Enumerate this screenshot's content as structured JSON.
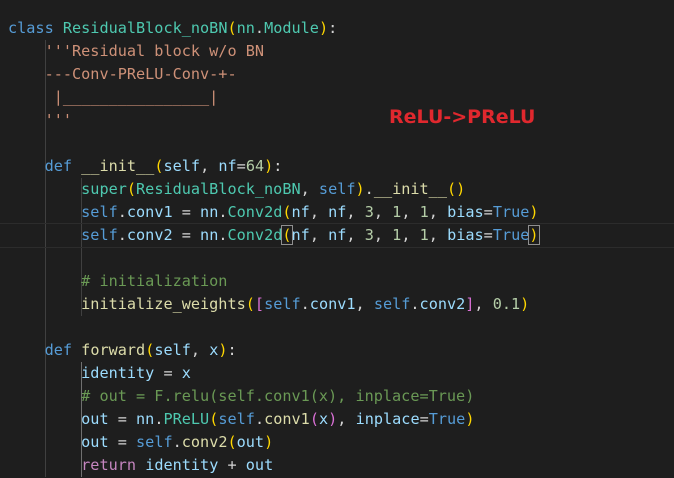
{
  "theme": {
    "background": "#1e1e1e",
    "foreground": "#d4d4d4",
    "keyword": "#569cd6",
    "control": "#c586c0",
    "class_name": "#4ec9b0",
    "function": "#dcdcaa",
    "variable": "#9cdcfe",
    "number": "#b5cea8",
    "string": "#ce9178",
    "comment": "#6a9955",
    "bracket_1": "#ffd700",
    "bracket_2": "#da70d6",
    "bracket_3": "#179fff",
    "annotation": "#e0282e"
  },
  "annotation": {
    "text": "ReLU->PReLU"
  },
  "code": {
    "lines": [
      [
        [
          "class",
          "keyword"
        ],
        [
          " ",
          "plain"
        ],
        [
          "ResidualBlock_noBN",
          "class_name"
        ],
        [
          "(",
          "bracket_1"
        ],
        [
          "nn",
          "class_name"
        ],
        [
          ".",
          "plain"
        ],
        [
          "Module",
          "class_name"
        ],
        [
          ")",
          "bracket_1"
        ],
        [
          ":",
          "plain"
        ]
      ],
      [
        [
          "    ",
          "plain"
        ],
        [
          "'''Residual block w/o BN",
          "string"
        ]
      ],
      [
        [
          "    ",
          "plain"
        ],
        [
          "---Conv-PReLU-Conv-+-",
          "string"
        ]
      ],
      [
        [
          "     ",
          "plain"
        ],
        [
          "|________________|",
          "string"
        ]
      ],
      [
        [
          "    ",
          "plain"
        ],
        [
          "'''",
          "string"
        ]
      ],
      [],
      [
        [
          "    ",
          "plain"
        ],
        [
          "def",
          "keyword"
        ],
        [
          " ",
          "plain"
        ],
        [
          "__init__",
          "function"
        ],
        [
          "(",
          "bracket_1"
        ],
        [
          "self",
          "variable"
        ],
        [
          ", ",
          "plain"
        ],
        [
          "nf",
          "variable"
        ],
        [
          "=",
          "plain"
        ],
        [
          "64",
          "number"
        ],
        [
          ")",
          "bracket_1"
        ],
        [
          ":",
          "plain"
        ]
      ],
      [
        [
          "        ",
          "plain"
        ],
        [
          "super",
          "class_name"
        ],
        [
          "(",
          "bracket_1"
        ],
        [
          "ResidualBlock_noBN",
          "class_name"
        ],
        [
          ", ",
          "plain"
        ],
        [
          "self",
          "keyword"
        ],
        [
          ")",
          "bracket_1"
        ],
        [
          ".",
          "plain"
        ],
        [
          "__init__",
          "function"
        ],
        [
          "()",
          "bracket_1"
        ]
      ],
      [
        [
          "        ",
          "plain"
        ],
        [
          "self",
          "keyword"
        ],
        [
          ".",
          "plain"
        ],
        [
          "conv1",
          "variable"
        ],
        [
          " = ",
          "plain"
        ],
        [
          "nn",
          "variable"
        ],
        [
          ".",
          "plain"
        ],
        [
          "Conv2d",
          "class_name"
        ],
        [
          "(",
          "bracket_1"
        ],
        [
          "nf",
          "variable"
        ],
        [
          ", ",
          "plain"
        ],
        [
          "nf",
          "variable"
        ],
        [
          ", ",
          "plain"
        ],
        [
          "3",
          "number"
        ],
        [
          ", ",
          "plain"
        ],
        [
          "1",
          "number"
        ],
        [
          ", ",
          "plain"
        ],
        [
          "1",
          "number"
        ],
        [
          ", ",
          "plain"
        ],
        [
          "bias",
          "variable"
        ],
        [
          "=",
          "plain"
        ],
        [
          "True",
          "keyword"
        ],
        [
          ")",
          "bracket_1"
        ]
      ],
      [
        [
          "        ",
          "plain"
        ],
        [
          "self",
          "keyword"
        ],
        [
          ".",
          "plain"
        ],
        [
          "conv2",
          "variable"
        ],
        [
          " = ",
          "plain"
        ],
        [
          "nn",
          "variable"
        ],
        [
          ".",
          "plain"
        ],
        [
          "Conv2d",
          "class_name"
        ],
        [
          "(",
          "bracket_1",
          "bm"
        ],
        [
          "nf",
          "variable"
        ],
        [
          ", ",
          "plain"
        ],
        [
          "nf",
          "variable"
        ],
        [
          ", ",
          "plain"
        ],
        [
          "3",
          "number"
        ],
        [
          ", ",
          "plain"
        ],
        [
          "1",
          "number"
        ],
        [
          ", ",
          "plain"
        ],
        [
          "1",
          "number"
        ],
        [
          ", ",
          "plain"
        ],
        [
          "bias",
          "variable"
        ],
        [
          "=",
          "plain"
        ],
        [
          "True",
          "keyword"
        ],
        [
          ")",
          "bracket_1",
          "bm"
        ]
      ],
      [],
      [
        [
          "        ",
          "plain"
        ],
        [
          "# initialization",
          "comment"
        ]
      ],
      [
        [
          "        ",
          "plain"
        ],
        [
          "initialize_weights",
          "function"
        ],
        [
          "(",
          "bracket_1"
        ],
        [
          "[",
          "bracket_2"
        ],
        [
          "self",
          "keyword"
        ],
        [
          ".",
          "plain"
        ],
        [
          "conv1",
          "variable"
        ],
        [
          ", ",
          "plain"
        ],
        [
          "self",
          "keyword"
        ],
        [
          ".",
          "plain"
        ],
        [
          "conv2",
          "variable"
        ],
        [
          "]",
          "bracket_2"
        ],
        [
          ", ",
          "plain"
        ],
        [
          "0.1",
          "number"
        ],
        [
          ")",
          "bracket_1"
        ]
      ],
      [],
      [
        [
          "    ",
          "plain"
        ],
        [
          "def",
          "keyword"
        ],
        [
          " ",
          "plain"
        ],
        [
          "forward",
          "function"
        ],
        [
          "(",
          "bracket_1"
        ],
        [
          "self",
          "variable"
        ],
        [
          ", ",
          "plain"
        ],
        [
          "x",
          "variable"
        ],
        [
          ")",
          "bracket_1"
        ],
        [
          ":",
          "plain"
        ]
      ],
      [
        [
          "        ",
          "plain"
        ],
        [
          "identity",
          "variable"
        ],
        [
          " = ",
          "plain"
        ],
        [
          "x",
          "variable"
        ]
      ],
      [
        [
          "        ",
          "plain"
        ],
        [
          "# out = F.relu(self.conv1(x), inplace=True)",
          "comment"
        ]
      ],
      [
        [
          "        ",
          "plain"
        ],
        [
          "out",
          "variable"
        ],
        [
          " = ",
          "plain"
        ],
        [
          "nn",
          "variable"
        ],
        [
          ".",
          "plain"
        ],
        [
          "PReLU",
          "class_name"
        ],
        [
          "(",
          "bracket_1"
        ],
        [
          "self",
          "keyword"
        ],
        [
          ".",
          "plain"
        ],
        [
          "conv1",
          "function"
        ],
        [
          "(",
          "bracket_2"
        ],
        [
          "x",
          "variable"
        ],
        [
          ")",
          "bracket_2"
        ],
        [
          ", ",
          "plain"
        ],
        [
          "inplace",
          "variable"
        ],
        [
          "=",
          "plain"
        ],
        [
          "True",
          "keyword"
        ],
        [
          ")",
          "bracket_1"
        ]
      ],
      [
        [
          "        ",
          "plain"
        ],
        [
          "out",
          "variable"
        ],
        [
          " = ",
          "plain"
        ],
        [
          "self",
          "keyword"
        ],
        [
          ".",
          "plain"
        ],
        [
          "conv2",
          "function"
        ],
        [
          "(",
          "bracket_1"
        ],
        [
          "out",
          "variable"
        ],
        [
          ")",
          "bracket_1"
        ]
      ],
      [
        [
          "        ",
          "plain"
        ],
        [
          "return",
          "control"
        ],
        [
          " ",
          "plain"
        ],
        [
          "identity",
          "variable"
        ],
        [
          " + ",
          "plain"
        ],
        [
          "out",
          "variable"
        ]
      ]
    ]
  }
}
